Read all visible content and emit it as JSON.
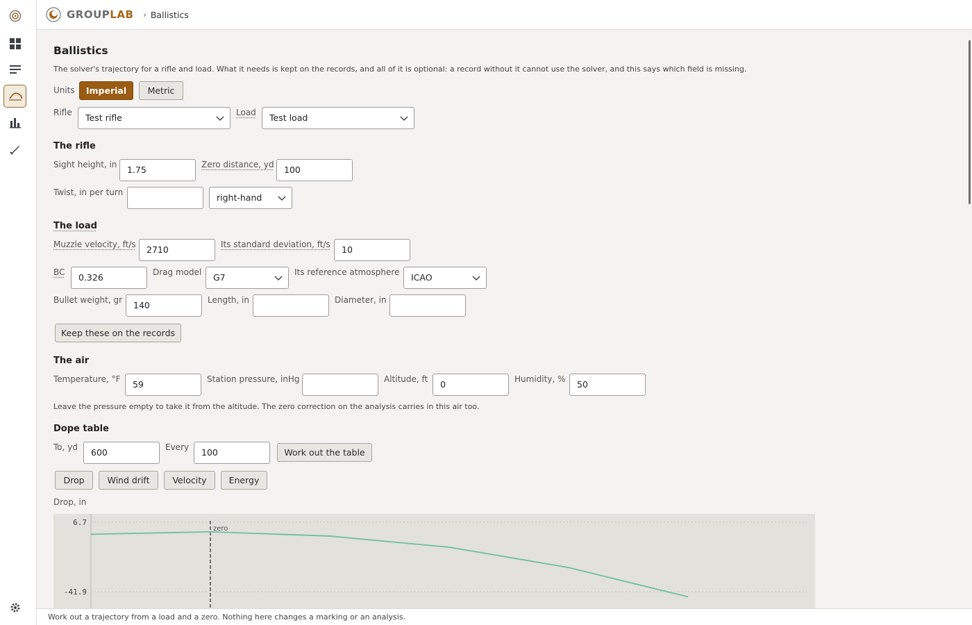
{
  "brand": {
    "name_a": "GROUP",
    "name_b": "LAB"
  },
  "breadcrumb": {
    "sep": "›",
    "current": "Ballistics"
  },
  "page": {
    "title": "Ballistics",
    "description": "The solver's trajectory for a rifle and load. What it needs is kept on the records, and all of it is optional: a record without it cannot use the solver, and this says which field is missing."
  },
  "units": {
    "label": "Units",
    "imperial": "Imperial",
    "metric": "Metric",
    "selected": "Imperial"
  },
  "selection": {
    "rifle_label": "Rifle",
    "rifle_value": "Test rifle",
    "load_label": "Load",
    "load_value": "Test load"
  },
  "rifle": {
    "heading": "The rifle",
    "sight_height_label": "Sight height, in",
    "sight_height": "1.75",
    "zero_distance_label": "Zero distance, yd",
    "zero_distance": "100",
    "twist_label": "Twist, in per turn",
    "twist": "",
    "twist_direction": "right-hand"
  },
  "load": {
    "heading": "The load",
    "mv_label": "Muzzle velocity, ft/s",
    "mv": "2710",
    "sd_label": "Its standard deviation, ft/s",
    "sd": "10",
    "bc_label": "BC",
    "bc": "0.326",
    "drag_label": "Drag model",
    "drag": "G7",
    "atmos_label": "Its reference atmosphere",
    "atmos": "ICAO",
    "weight_label": "Bullet weight, gr",
    "weight": "140",
    "length_label": "Length, in",
    "length": "",
    "diameter_label": "Diameter, in",
    "diameter": "",
    "keep_button": "Keep these on the records"
  },
  "air": {
    "heading": "The air",
    "temp_label": "Temperature, °F",
    "temp": "59",
    "pressure_label": "Station pressure, inHg",
    "pressure": "",
    "altitude_label": "Altitude, ft",
    "altitude": "0",
    "humidity_label": "Humidity, %",
    "humidity": "50",
    "note": "Leave the pressure empty to take it from the altitude. The zero correction on the analysis carries in this air too."
  },
  "dope": {
    "heading": "Dope table",
    "to_label": "To, yd",
    "to": "600",
    "every_label": "Every",
    "every": "100",
    "work_button": "Work out the table",
    "tabs": [
      "Drop",
      "Wind drift",
      "Velocity",
      "Energy"
    ]
  },
  "chart_data": {
    "type": "line",
    "ylabel": "Drop, in",
    "yticks": [
      "6.7",
      "-41.9"
    ],
    "ylim": [
      -52,
      6.7
    ],
    "x": [
      0,
      100,
      200,
      300,
      400,
      500
    ],
    "series": [
      {
        "values": [
          -1.75,
          0,
          -3.0,
          -10.8,
          -25.0,
          -45.5
        ]
      }
    ],
    "zero_marker": {
      "x": 100,
      "label": "zero"
    },
    "line_color": "#6fbfa1"
  },
  "status": "Work out a trajectory from a load and a zero. Nothing here changes a marking or an analysis."
}
